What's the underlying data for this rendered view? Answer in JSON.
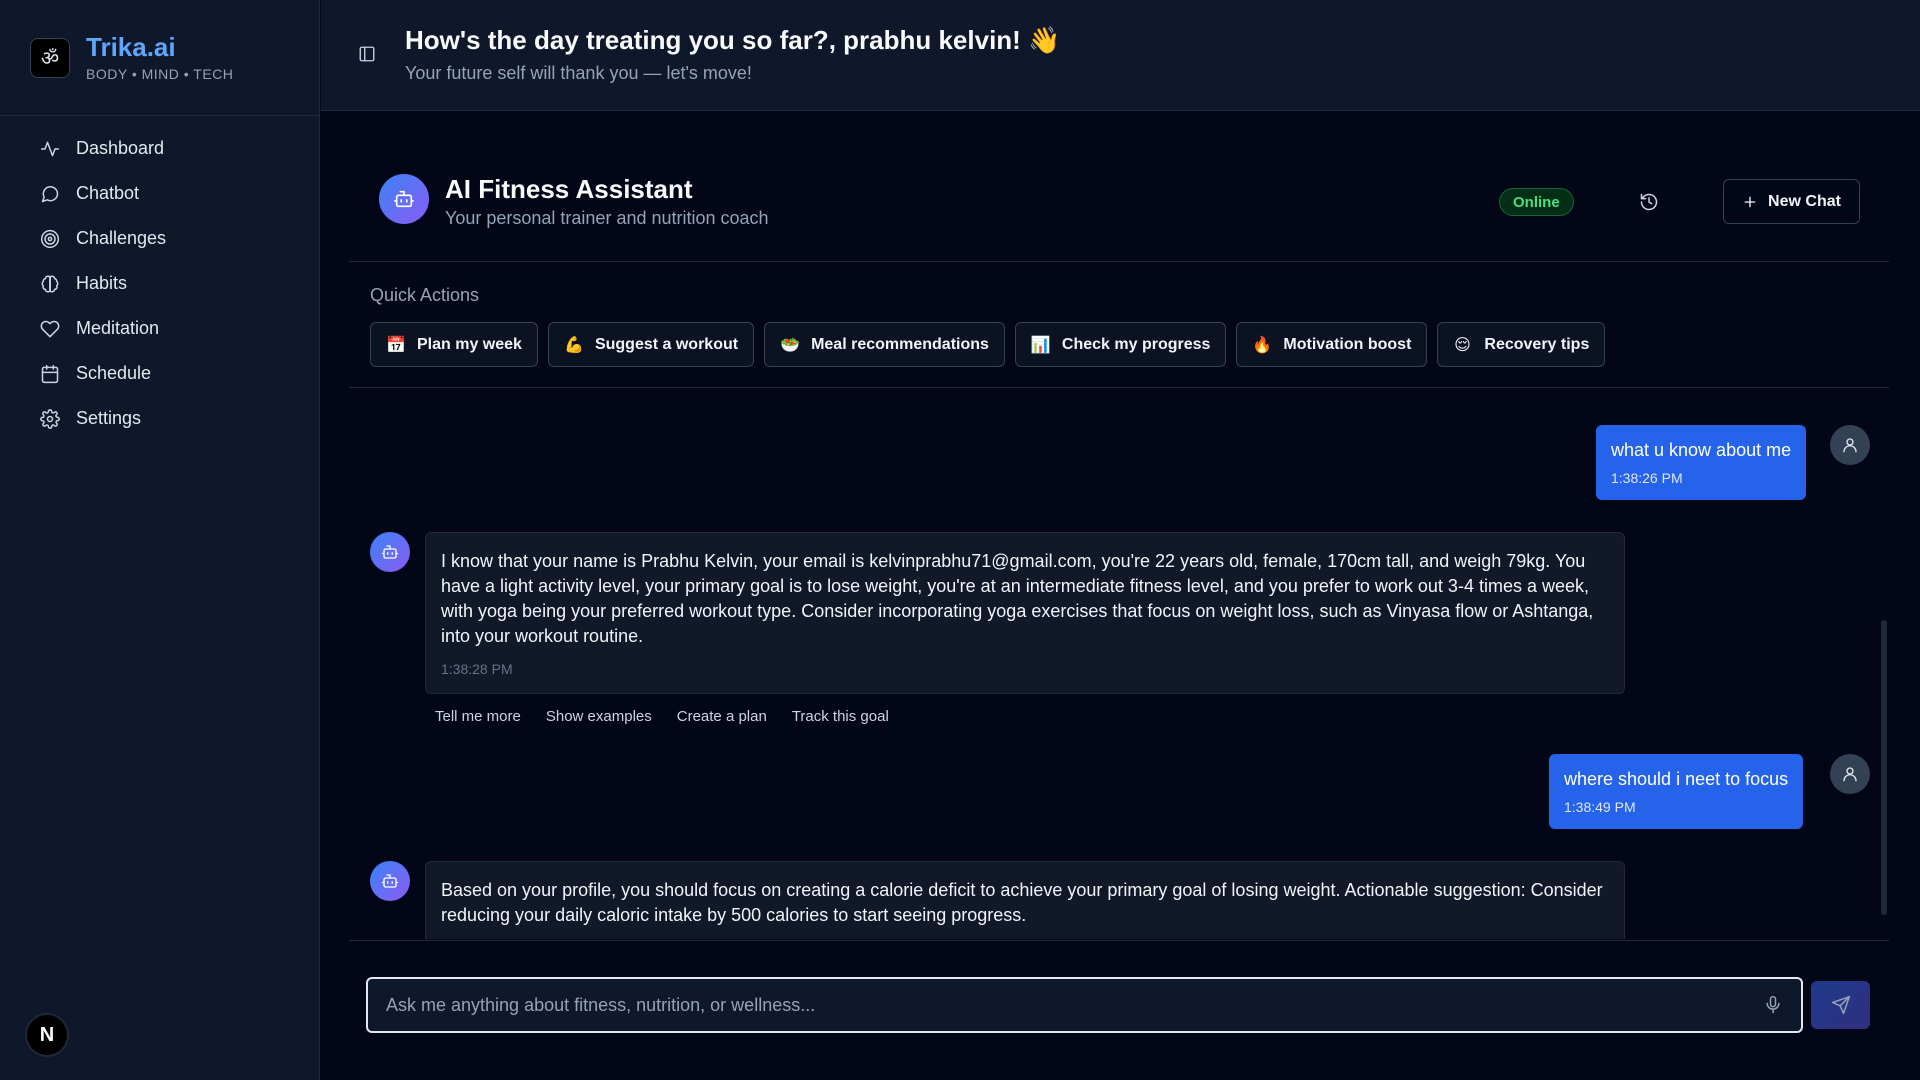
{
  "brand": {
    "name": "Trika.ai",
    "tagline": "BODY • MIND • TECH",
    "logo_icon": "trika-logo"
  },
  "sidebar": {
    "items": [
      {
        "label": "Dashboard",
        "icon": "activity-icon"
      },
      {
        "label": "Chatbot",
        "icon": "message-circle-icon"
      },
      {
        "label": "Challenges",
        "icon": "target-icon"
      },
      {
        "label": "Habits",
        "icon": "brain-icon"
      },
      {
        "label": "Meditation",
        "icon": "heart-icon"
      },
      {
        "label": "Schedule",
        "icon": "calendar-icon"
      },
      {
        "label": "Settings",
        "icon": "gear-icon"
      }
    ],
    "footer_avatar": "N"
  },
  "header": {
    "greeting": "How's the day treating you so far?, prabhu kelvin! 👋",
    "subtitle": "Your future self will thank you — let's move!"
  },
  "assistant": {
    "title": "AI Fitness Assistant",
    "subtitle": "Your personal trainer and nutrition coach",
    "status": "Online",
    "new_chat_label": "New Chat"
  },
  "quick_actions": {
    "label": "Quick Actions",
    "items": [
      {
        "emoji": "📅",
        "label": "Plan my week"
      },
      {
        "emoji": "💪",
        "label": "Suggest a workout"
      },
      {
        "emoji": "🥗",
        "label": "Meal recommendations"
      },
      {
        "emoji": "📊",
        "label": "Check my progress"
      },
      {
        "emoji": "🔥",
        "label": "Motivation boost"
      },
      {
        "emoji": "😌",
        "label": "Recovery tips"
      }
    ]
  },
  "messages": [
    {
      "role": "user",
      "text": "what u know about me",
      "time": "1:38:26 PM"
    },
    {
      "role": "bot",
      "text": "I know that your name is Prabhu Kelvin, your email is kelvinprabhu71@gmail.com, you're 22 years old, female, 170cm tall, and weigh 79kg. You have a light activity level, your primary goal is to lose weight, you're at an intermediate fitness level, and you prefer to work out 3-4 times a week, with yoga being your preferred workout type. Consider incorporating yoga exercises that focus on weight loss, such as Vinyasa flow or Ashtanga, into your workout routine.",
      "time": "1:38:28 PM"
    },
    {
      "role": "user",
      "text": "where should i neet to focus",
      "time": "1:38:49 PM"
    },
    {
      "role": "bot",
      "text": "Based on your profile, you should focus on creating a calorie deficit to achieve your primary goal of losing weight. Actionable suggestion: Consider reducing your daily caloric intake by 500 calories to start seeing progress.",
      "time": ""
    }
  ],
  "suggestions": [
    "Tell me more",
    "Show examples",
    "Create a plan",
    "Track this goal"
  ],
  "composer": {
    "placeholder": "Ask me anything about fitness, nutrition, or wellness..."
  },
  "colors": {
    "accent": "#2563eb",
    "brand": "#60a5fa",
    "online": "#4ade80",
    "background": "#020617"
  }
}
